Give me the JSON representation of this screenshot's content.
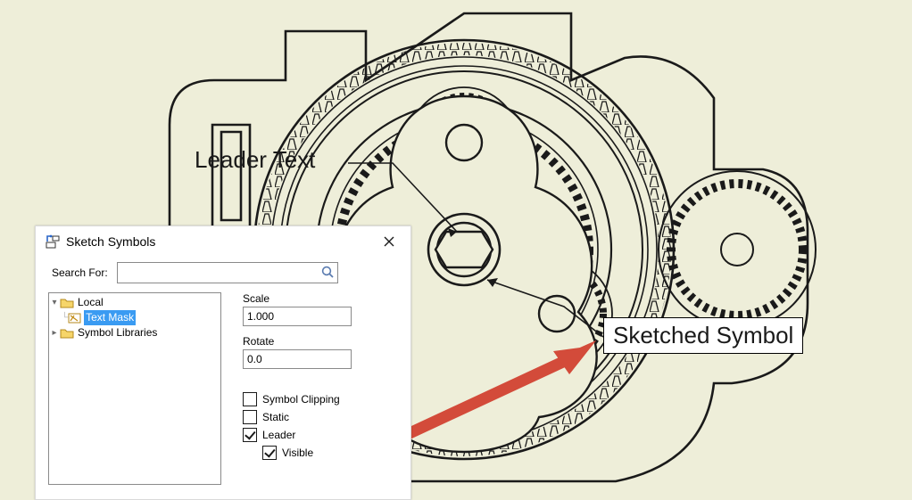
{
  "canvas": {
    "leader_text_label": "Leader Text",
    "sketched_symbol_label": "Sketched Symbol"
  },
  "dialog": {
    "title": "Sketch Symbols",
    "search_label": "Search For:",
    "search_value": "",
    "search_placeholder": "",
    "tree": {
      "root": "Local",
      "selected": "Text Mask",
      "libs": "Symbol Libraries"
    },
    "props": {
      "scale_label": "Scale",
      "scale_value": "1.000",
      "rotate_label": "Rotate",
      "rotate_value": "0.0",
      "symbol_clipping_label": "Symbol Clipping",
      "symbol_clipping_checked": false,
      "static_label": "Static",
      "static_checked": false,
      "leader_label": "Leader",
      "leader_checked": true,
      "visible_label": "Visible",
      "visible_checked": true
    }
  }
}
